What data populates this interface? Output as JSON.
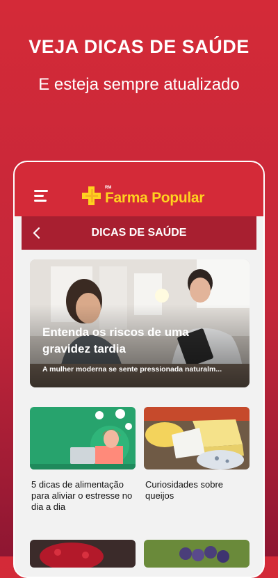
{
  "promo": {
    "title": "VEJA DICAS DE SAÚDE",
    "subtitle": "E esteja sempre atualizado"
  },
  "app": {
    "logo_prefix": "RM",
    "logo_text": "Farma Popular",
    "section_title": "DICAS DE SAÚDE"
  },
  "feature": {
    "title": "Entenda os riscos de uma gravidez tardia",
    "subtitle": "A mulher moderna se sente pressionada naturalm..."
  },
  "cards": [
    {
      "title": "5 dicas de alimentação para aliviar o estresse no dia a dia"
    },
    {
      "title": "Curiosidades sobre queijos"
    }
  ],
  "colors": {
    "brand_red": "#d42a38",
    "section_red": "#a81f30",
    "logo_yellow": "#ffd21f"
  },
  "icons": [
    "menu-icon",
    "back-arrow-icon",
    "logo-cross-icon"
  ]
}
